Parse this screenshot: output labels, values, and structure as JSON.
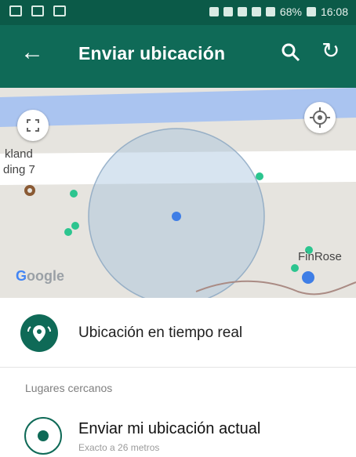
{
  "status_bar": {
    "battery": "68%",
    "time": "16:08"
  },
  "toolbar": {
    "title": "Enviar ubicación"
  },
  "map": {
    "labels": [
      "kland",
      "ding 7",
      "FinRose"
    ],
    "attribution_prefix": "G",
    "attribution_rest": "oogle"
  },
  "actions": {
    "realtime_label": "Ubicación en tiempo real",
    "nearby_header": "Lugares cercanos",
    "send_title": "Enviar mi ubicación actual",
    "send_subtitle": "Exacto a 26 metros"
  },
  "colors": {
    "primary": "#0f6a57",
    "status": "#0b5a48",
    "map_bg": "#e6e4df"
  }
}
